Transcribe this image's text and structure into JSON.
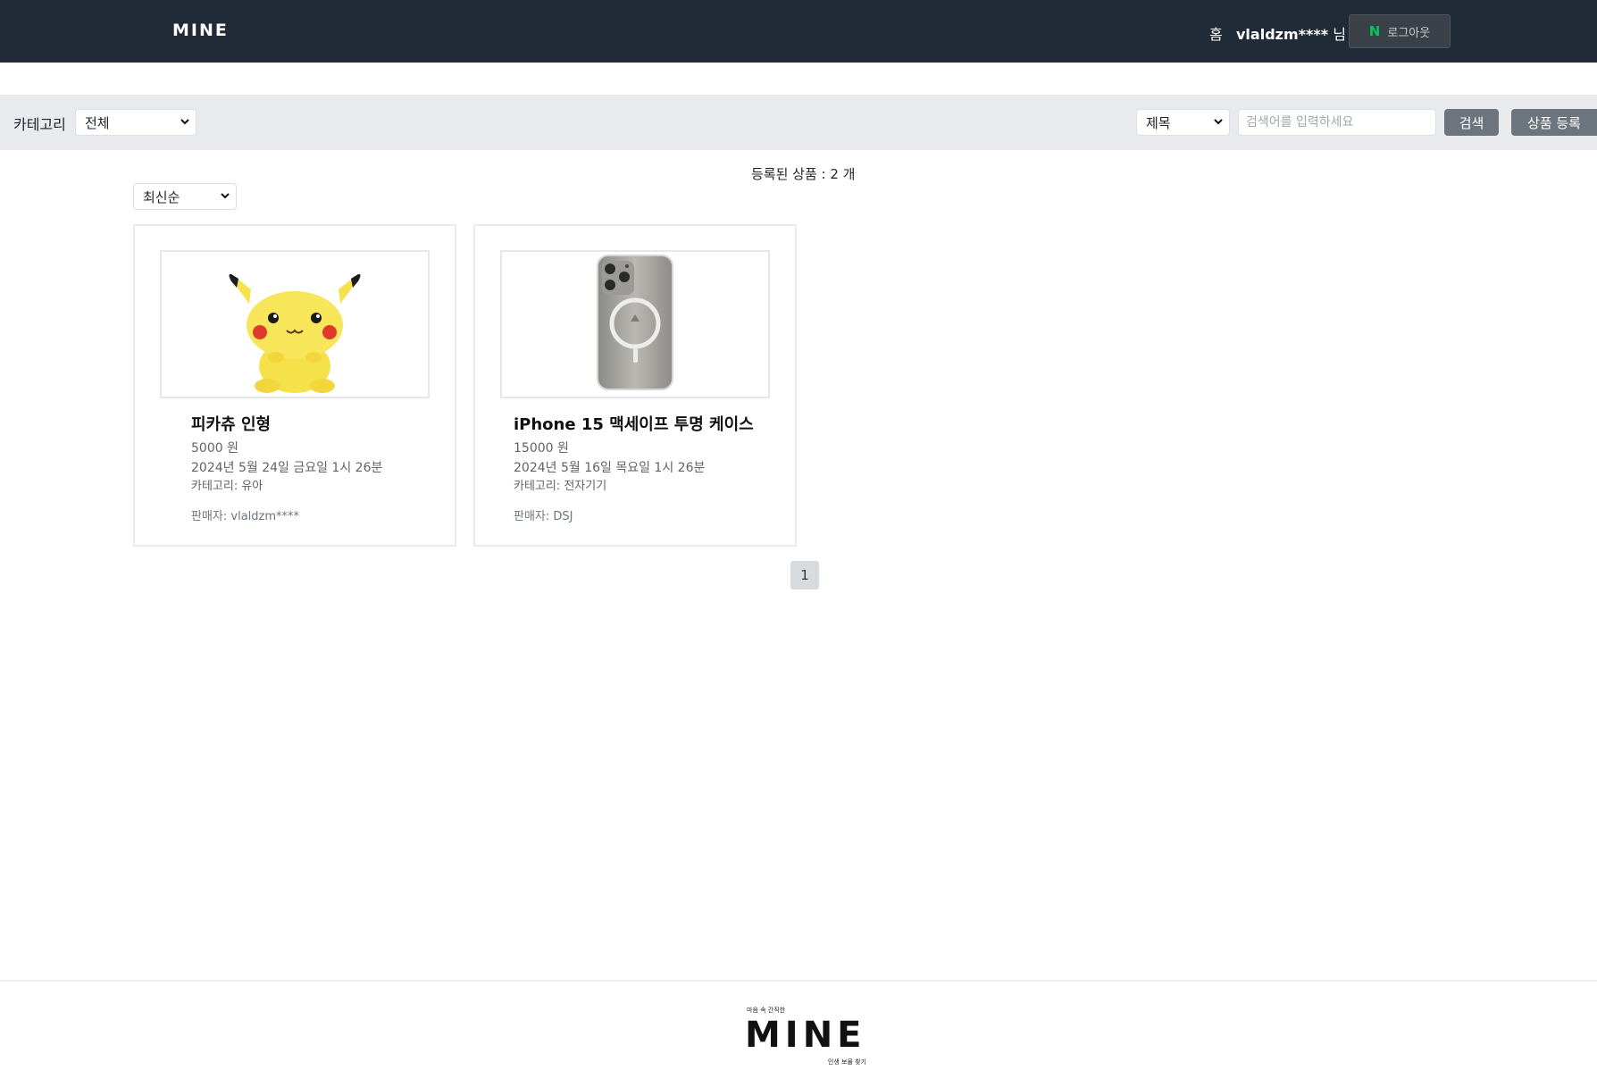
{
  "navbar": {
    "brand": "MINE",
    "home_label": "홈",
    "user_name": "vlaldzm****",
    "user_suffix": " 님",
    "logout_icon_text": "N",
    "logout_label": "로그아웃",
    "bg_color": "#212a37"
  },
  "filters": {
    "category_label": "카테고리",
    "category_selected": "전체",
    "search_field_selected": "제목",
    "search_placeholder": "검색어를 입력하세요",
    "search_button": "검색",
    "register_button": "상품 등록"
  },
  "listing": {
    "count_text": "등록된 상품 : 2 개",
    "sort_selected": "최신순",
    "products": [
      {
        "title": "피카츄 인형",
        "price": "5000 원",
        "date": "2024년 5월 24일 금요일 1시 26분",
        "category": "카테고리: 유아",
        "seller": "판매자: vlaldzm****",
        "image": "pikachu-plush"
      },
      {
        "title": "iPhone 15 맥세이프 투명 케이스",
        "price": "15000 원",
        "date": "2024년 5월 16일 목요일 1시 26분",
        "category": "카테고리: 전자기기",
        "seller": "판매자: DSJ",
        "image": "iphone-clear-case"
      }
    ]
  },
  "pagination": {
    "current_page": "1"
  },
  "footer": {
    "logo_top": "마음 속 간직한",
    "logo_text": "MINE",
    "logo_bottom": "인생 보물 찾기"
  }
}
